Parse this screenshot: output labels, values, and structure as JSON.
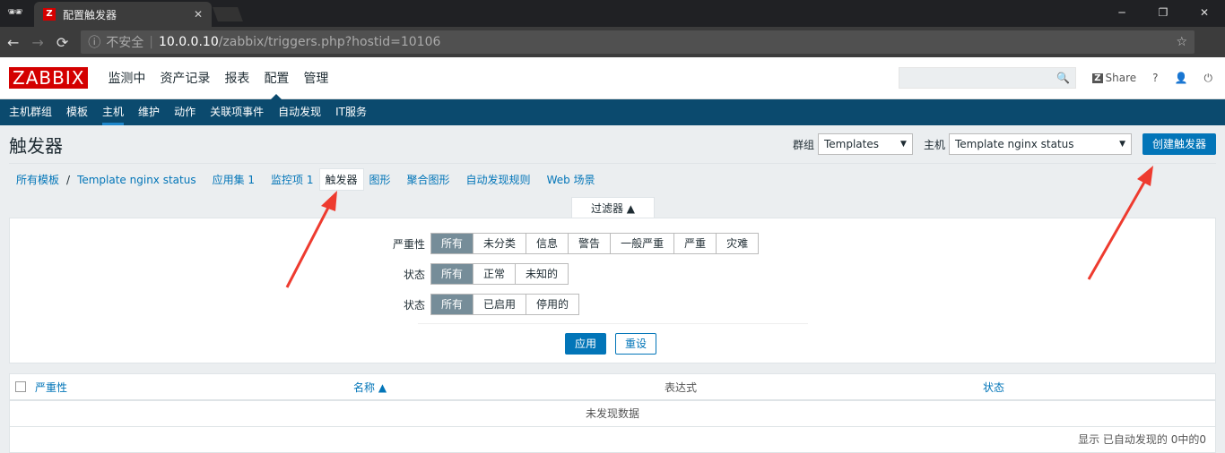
{
  "browser": {
    "tab_title": "配置触发器",
    "favicon": "Z",
    "security": "不安全",
    "url_host": "10.0.0.10",
    "url_path": "/zabbix/triggers.php?hostid=10106"
  },
  "header": {
    "logo": "ZABBIX",
    "menu": [
      "监测中",
      "资产记录",
      "报表",
      "配置",
      "管理"
    ],
    "share": "Share",
    "help": "?"
  },
  "subnav": [
    "主机群组",
    "模板",
    "主机",
    "维护",
    "动作",
    "关联项事件",
    "自动发现",
    "IT服务"
  ],
  "page": {
    "title": "触发器",
    "group_label": "群组",
    "group_value": "Templates",
    "host_label": "主机",
    "host_value": "Template nginx status",
    "create_button": "创建触发器"
  },
  "breadcrumbs": {
    "all": "所有模板",
    "sep": "/",
    "template": "Template nginx status",
    "apps": "应用集 1",
    "items": "监控项 1",
    "triggers": "触发器",
    "graphs": "图形",
    "screens": "聚合图形",
    "discovery": "自动发现规则",
    "web": "Web 场景"
  },
  "filter": {
    "tab": "过滤器 ▲",
    "severity_label": "严重性",
    "severity": [
      "所有",
      "未分类",
      "信息",
      "警告",
      "一般严重",
      "严重",
      "灾难"
    ],
    "state_label": "状态",
    "state": [
      "所有",
      "正常",
      "未知的"
    ],
    "status_label": "状态",
    "status": [
      "所有",
      "已启用",
      "停用的"
    ],
    "apply": "应用",
    "reset": "重设"
  },
  "table": {
    "columns": [
      "严重性",
      "名称 ▲",
      "表达式",
      "状态"
    ],
    "empty": "未发现数据",
    "footer": "显示 已自动发现的 0中的0"
  }
}
